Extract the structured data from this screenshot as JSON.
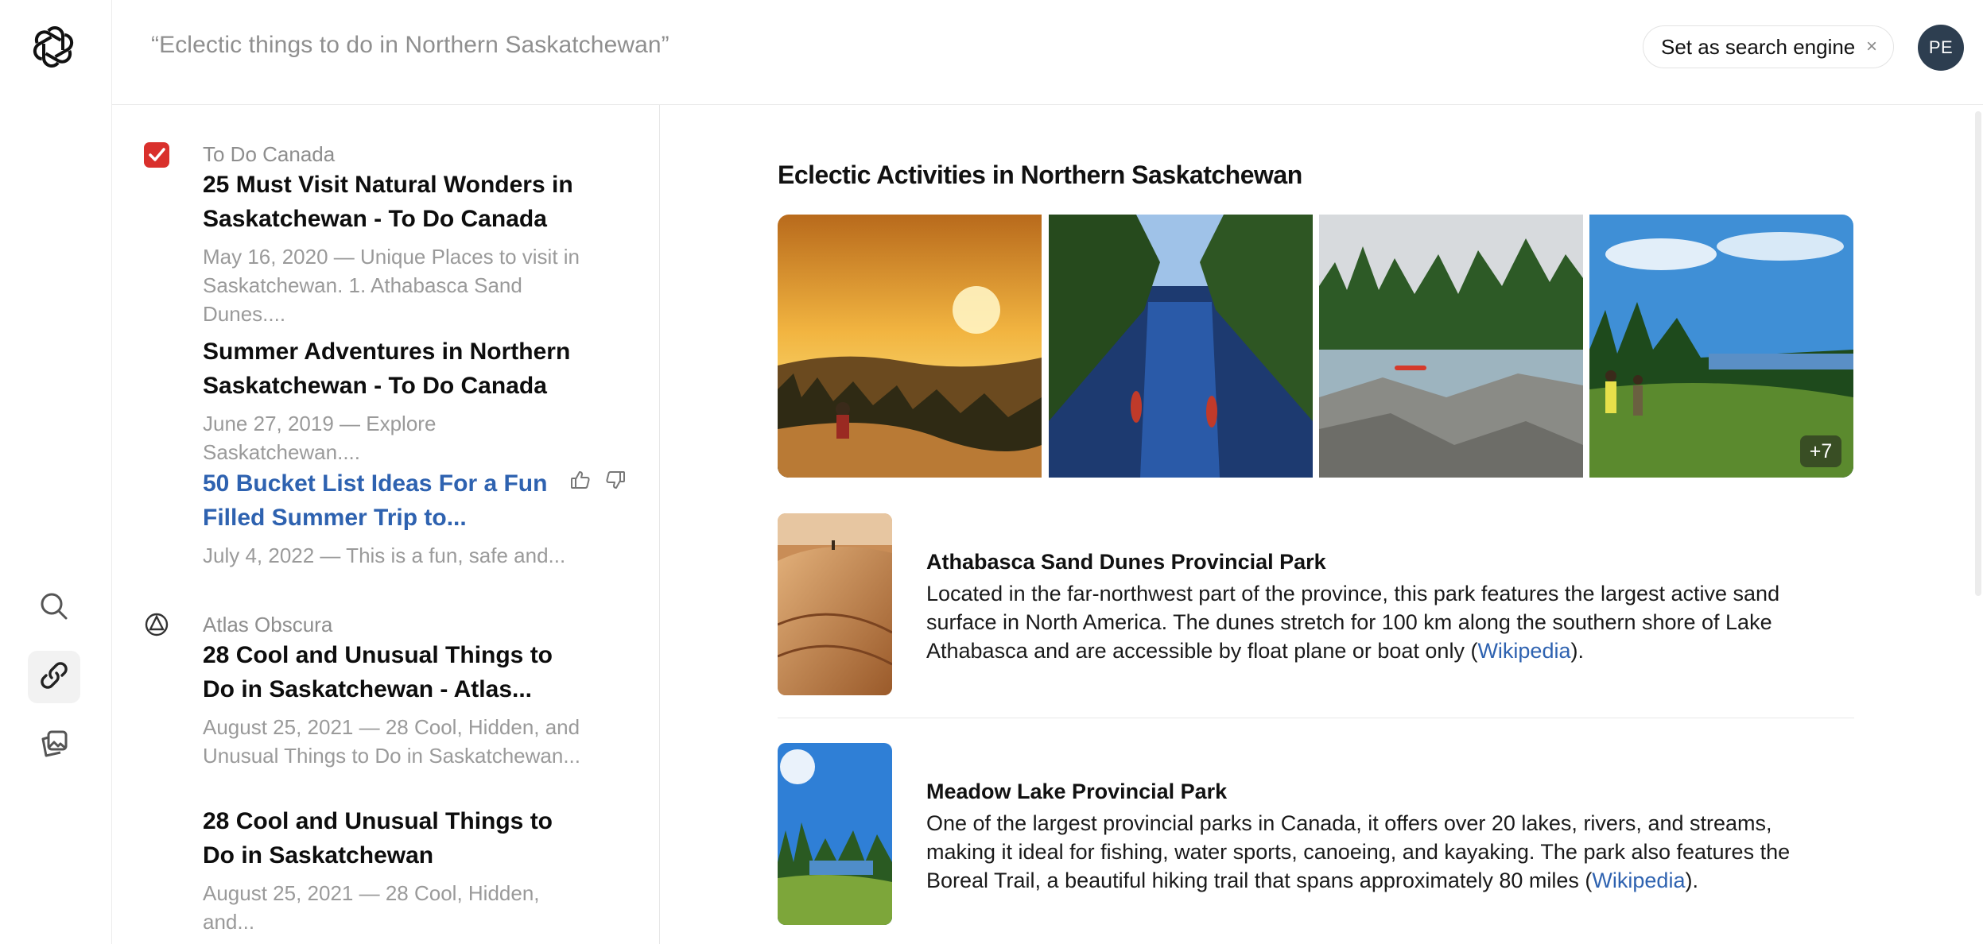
{
  "query": "“Eclectic things to do in Northern Saskatchewan”",
  "engine_button": {
    "label": "Set as search engine",
    "close": "×"
  },
  "avatar": "PE",
  "icons": {
    "logo": "openai-logo-icon",
    "search": "search-icon",
    "links": "link-icon",
    "images": "images-icon",
    "thumbs_up": "thumbs-up-icon",
    "thumbs_down": "thumbs-down-icon"
  },
  "results": [
    {
      "source": "To Do Canada",
      "items": [
        {
          "title_1": "25 Must Visit Natural Wonders in",
          "title_2": "Saskatchewan - To Do Canada",
          "snippet_1": "May 16, 2020 — Unique Places to visit in",
          "snippet_2": "Saskatchewan. 1. Athabasca Sand Dunes...."
        },
        {
          "title_1": "Summer Adventures in Northern",
          "title_2": "Saskatchewan - To Do Canada",
          "snippet_1": "June 27, 2019 — Explore Saskatchewan...."
        },
        {
          "title_1": "50 Bucket List Ideas For a Fun",
          "title_2": "Filled Summer Trip to...",
          "snippet_1": "July 4, 2022 — This is a fun, safe and..."
        }
      ]
    },
    {
      "source": "Atlas Obscura",
      "items": [
        {
          "title_1": "28 Cool and Unusual Things to",
          "title_2": "Do in Saskatchewan - Atlas...",
          "snippet_1": "August 25, 2021 — 28 Cool, Hidden, and",
          "snippet_2": "Unusual Things to Do in Saskatchewan..."
        },
        {
          "title_1": "28 Cool and Unusual Things to",
          "title_2": "Do in Saskatchewan",
          "snippet_1": "August 25, 2021 — 28 Cool, Hidden, and..."
        }
      ]
    }
  ],
  "main": {
    "title": "Eclectic Activities in Northern Saskatchewan",
    "more_images": "+7",
    "cards": [
      {
        "title": "Athabasca Sand Dunes Provincial Park",
        "desc_1": "Located in the far-northwest part of the province, this park features the largest active sand",
        "desc_2": "surface in North America. The dunes stretch for 100 km along the southern shore of Lake",
        "desc_3_pre": "Athabasca and are accessible by float plane or boat only (",
        "link": "Wikipedia",
        "desc_3_post": ")."
      },
      {
        "title": "Meadow Lake Provincial Park",
        "desc_1": "One of the largest provincial parks in Canada, it offers over 20 lakes, rivers, and streams,",
        "desc_2": "making it ideal for fishing, water sports, canoeing, and kayaking. The park also features the",
        "desc_3_pre": "Boreal Trail, a beautiful hiking trail that spans approximately 80 miles (",
        "link": "Wikipedia",
        "desc_3_post": ")."
      }
    ]
  },
  "colors": {
    "link": "#2e62b0",
    "avatar_bg": "#2d3e50",
    "muted": "#9a9a9a"
  }
}
